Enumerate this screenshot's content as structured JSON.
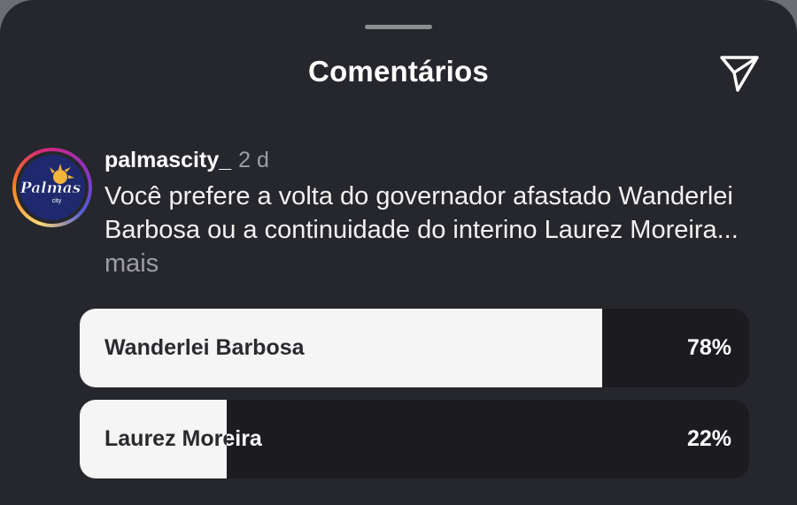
{
  "header": {
    "title": "Comentários",
    "share_icon": "paper-plane-icon"
  },
  "comment": {
    "avatar": {
      "logo_text": "Palmas",
      "logo_subtext": "city",
      "ring_colors": [
        "#feda75",
        "#fa7e1e",
        "#d62976",
        "#962fbf",
        "#4f5bd5"
      ]
    },
    "username": "palmascity_",
    "timestamp": "2 d",
    "text": "Você prefere a volta do governador afastado Wanderlei Barbosa ou a continuidade do interino Laurez Moreira...",
    "more_label": "mais"
  },
  "poll": {
    "options": [
      {
        "label": "Wanderlei Barbosa",
        "percent_label": "78%",
        "percent": 78
      },
      {
        "label": "Laurez Moreira",
        "percent_label": "22%",
        "percent": 22
      }
    ]
  },
  "colors": {
    "background": "#26272c",
    "poll_fill": "#f5f5f6",
    "poll_track": "#1c1c20",
    "muted_text": "#9d9ea3"
  }
}
